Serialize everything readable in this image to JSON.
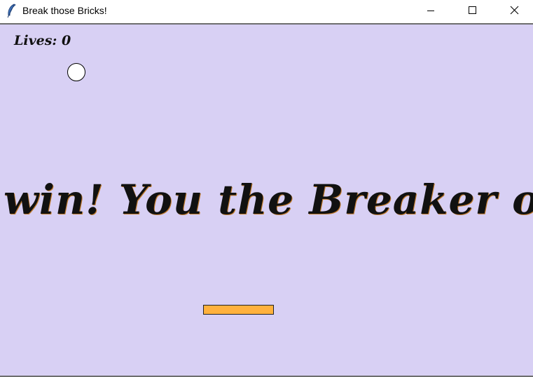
{
  "window": {
    "title": "Break those Bricks!",
    "app_icon": "feather-icon",
    "controls": {
      "minimize_icon": "minimize-icon",
      "maximize_icon": "maximize-icon",
      "close_icon": "close-icon"
    }
  },
  "game": {
    "lives_text": "Lives: 0",
    "banner_text": "win! You the Breaker of Bri",
    "colors": {
      "background": "#d8d0f4",
      "paddle": "#ffb13d",
      "ball": "#ffffff",
      "text": "#111111"
    }
  }
}
